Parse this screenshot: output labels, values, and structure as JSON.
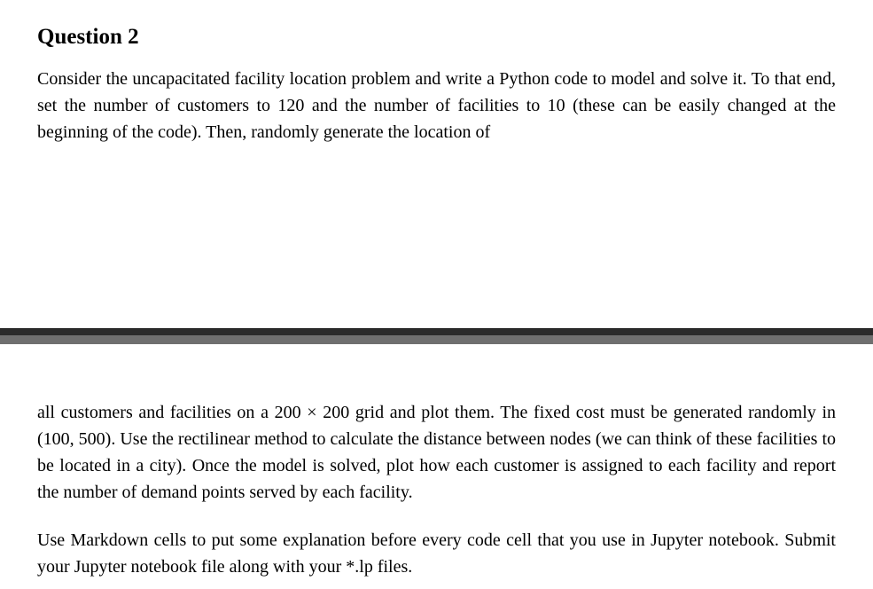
{
  "question": {
    "heading": "Question 2",
    "paragraph_top": "Consider the uncapacitated facility location problem and write a Python code to model and solve it.  To that end, set the number of customers to 120 and the number of facilities to 10 (these can be easily changed at the beginning of the code).  Then, randomly generate the location of",
    "paragraph_mid": "all customers and facilities on a 200 × 200 grid and plot them.  The fixed cost must be generated randomly in (100, 500). Use the rectilinear method to calculate the distance between nodes (we can think of these facilities to be located in a city). Once the model is solved, plot how each customer is assigned to each facility and report the number of demand points served by each facility.",
    "paragraph_bottom": "Use Markdown cells to put some explanation before every code cell that you use in Jupyter notebook. Submit your Jupyter notebook file along with your *.lp files."
  }
}
